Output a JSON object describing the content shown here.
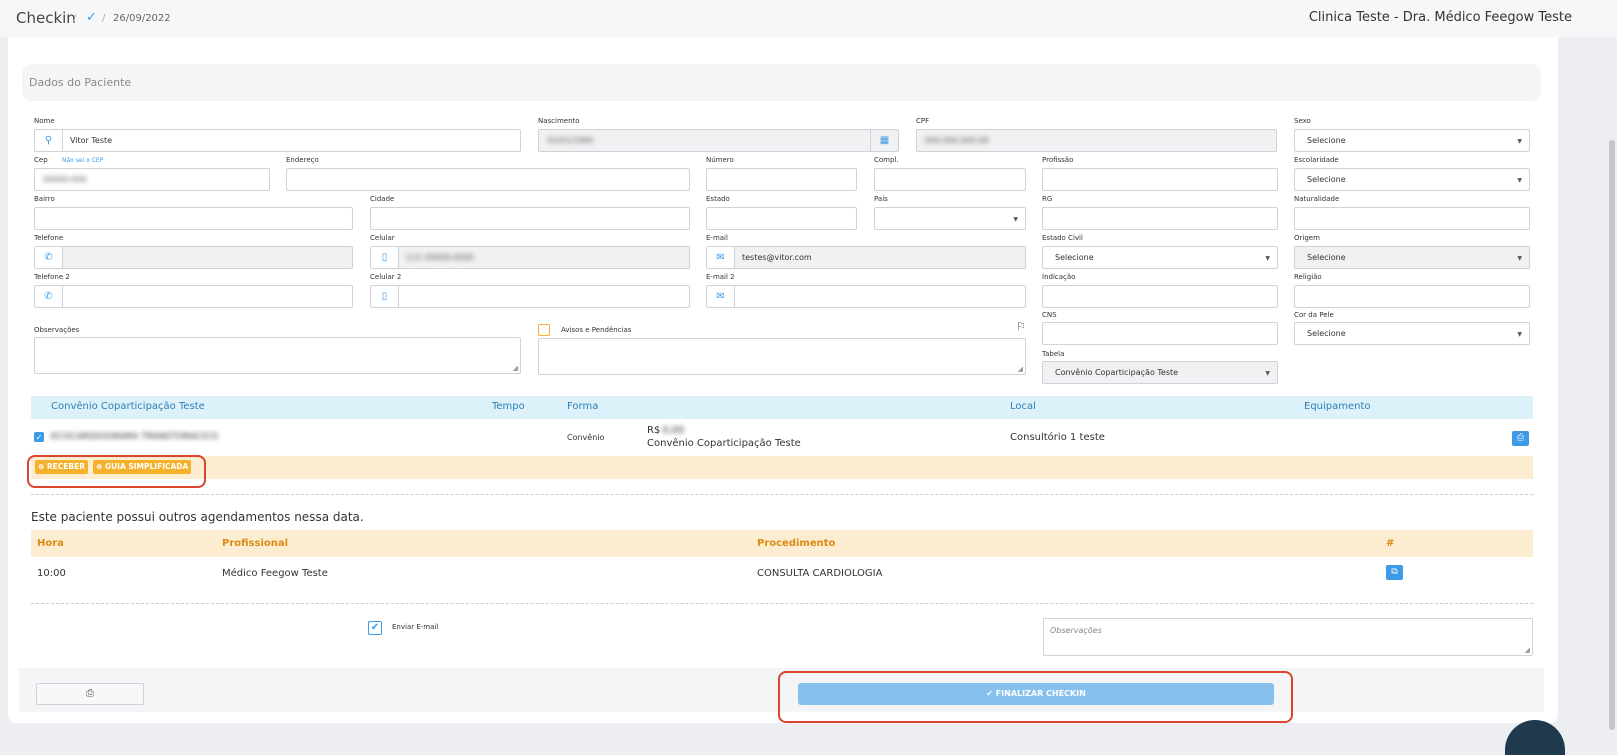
{
  "breadcrumb": {
    "title": "Checkin",
    "sep1": "/",
    "sep2": "/",
    "check_icon": "check-icon",
    "date": "26/09/2022"
  },
  "clinic_name": "Clinica Teste - Dra. Médico Feegow Teste",
  "section_title": "Dados do Paciente",
  "fields": {
    "nome": {
      "label": "Nome",
      "value": "Vitor Teste"
    },
    "nascimento": {
      "label": "Nascimento",
      "value": "01/01/1990"
    },
    "cpf": {
      "label": "CPF",
      "value": "000.000.000-00"
    },
    "sexo": {
      "label": "Sexo",
      "value": "Selecione"
    },
    "cep": {
      "label": "Cep",
      "link": "Não sei o CEP",
      "value": "00000-000"
    },
    "endereco": {
      "label": "Endereço"
    },
    "numero": {
      "label": "Número"
    },
    "compl": {
      "label": "Compl."
    },
    "profissao": {
      "label": "Profissão"
    },
    "escolaridade": {
      "label": "Escolaridade",
      "value": "Selecione"
    },
    "bairro": {
      "label": "Bairro"
    },
    "cidade": {
      "label": "Cidade"
    },
    "estado": {
      "label": "Estado"
    },
    "pais": {
      "label": "País"
    },
    "rg": {
      "label": "RG"
    },
    "naturalidade": {
      "label": "Naturalidade"
    },
    "telefone": {
      "label": "Telefone"
    },
    "celular": {
      "label": "Celular",
      "value": "(11) 00000-0000"
    },
    "email": {
      "label": "E-mail",
      "value": "testes@vitor.com"
    },
    "estado_civil": {
      "label": "Estado Civil",
      "value": "Selecione"
    },
    "origem": {
      "label": "Origem",
      "value": "Selecione"
    },
    "telefone2": {
      "label": "Telefone 2"
    },
    "celular2": {
      "label": "Celular 2"
    },
    "email2": {
      "label": "E-mail 2"
    },
    "indicacao": {
      "label": "Indicação"
    },
    "religiao": {
      "label": "Religião"
    },
    "observacoes": {
      "label": "Observações"
    },
    "avisos": {
      "label": "Avisos e Pendências"
    },
    "cns": {
      "label": "CNS"
    },
    "cor_pele": {
      "label": "Cor da Pele",
      "value": "Selecione"
    },
    "tabela": {
      "label": "Tabela",
      "value": "Convênio Coparticipação Teste"
    }
  },
  "procedures": {
    "headers": {
      "convenio": "Convênio Coparticipação Teste",
      "tempo": "Tempo",
      "forma": "Forma",
      "local": "Local",
      "equipamento": "Equipamento"
    },
    "row": {
      "name": "ECOCARDIOGRAMA TRANSTORACICO",
      "forma": "Convênio",
      "currency": "R$",
      "amount": "0,00",
      "convenio": "Convênio Coparticipação Teste",
      "local": "Consultório 1 teste"
    },
    "buttons": {
      "receber": "RECEBER",
      "guia": "GUIA SIMPLIFICADA"
    }
  },
  "schedule": {
    "notice": "Este paciente possui outros agendamentos nessa data.",
    "headers": {
      "hora": "Hora",
      "profissional": "Profissional",
      "procedimento": "Procedimento",
      "hash": "#"
    },
    "rows": [
      {
        "hora": "10:00",
        "profissional": "Médico Feegow Teste",
        "procedimento": "CONSULTA CARDIOLOGIA"
      }
    ]
  },
  "footer": {
    "enviar_email": "Enviar E-mail",
    "obs_placeholder": "Observações",
    "finalizar": "✔ FINALIZAR CHECKIN"
  },
  "colors": {
    "accent": "#3c9ae6",
    "warning": "#f3b12c",
    "highlight": "#d9452d"
  }
}
